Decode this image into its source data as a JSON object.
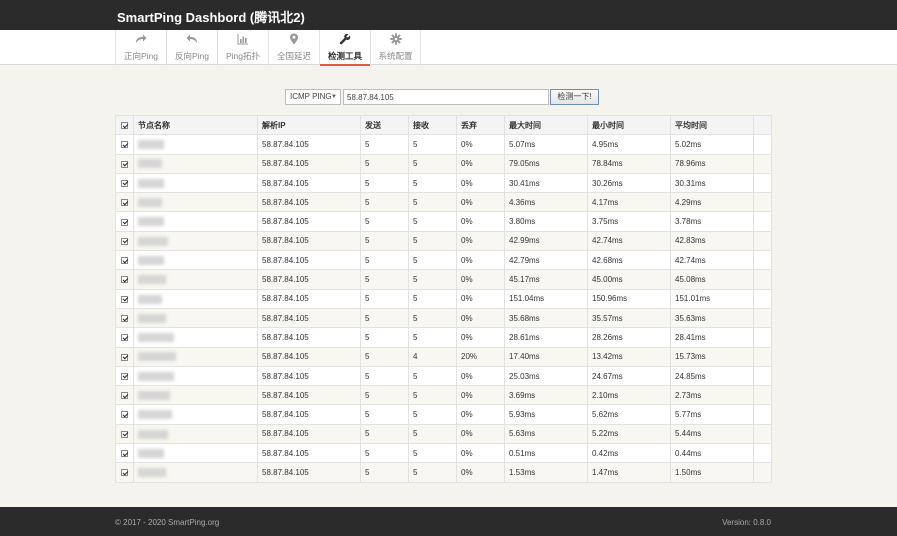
{
  "app": {
    "title": "SmartPing Dashbord (腾讯北2)"
  },
  "nav": [
    {
      "label": "正向Ping",
      "icon": "forward-arrow-icon",
      "active": false
    },
    {
      "label": "反向Ping",
      "icon": "reply-arrow-icon",
      "active": false
    },
    {
      "label": "Ping拓扑",
      "icon": "bar-chart-icon",
      "active": false
    },
    {
      "label": "全国延迟",
      "icon": "map-marker-icon",
      "active": false
    },
    {
      "label": "检测工具",
      "icon": "wrench-icon",
      "active": true
    },
    {
      "label": "系统配置",
      "icon": "gear-icon",
      "active": false
    }
  ],
  "toolbar": {
    "type_selected": "ICMP PING",
    "target_value": "58.87.84.105",
    "run_label": "检测一下!"
  },
  "table": {
    "headers": [
      "节点名称",
      "解析IP",
      "发送",
      "接收",
      "丢弃",
      "最大时间",
      "最小时间",
      "平均时间"
    ],
    "rows": [
      {
        "ip": "58.87.84.105",
        "sent": "5",
        "recv": "5",
        "loss": "0%",
        "max": "5.07ms",
        "min": "4.95ms",
        "avg": "5.02ms"
      },
      {
        "ip": "58.87.84.105",
        "sent": "5",
        "recv": "5",
        "loss": "0%",
        "max": "79.05ms",
        "min": "78.84ms",
        "avg": "78.96ms"
      },
      {
        "ip": "58.87.84.105",
        "sent": "5",
        "recv": "5",
        "loss": "0%",
        "max": "30.41ms",
        "min": "30.26ms",
        "avg": "30.31ms"
      },
      {
        "ip": "58.87.84.105",
        "sent": "5",
        "recv": "5",
        "loss": "0%",
        "max": "4.36ms",
        "min": "4.17ms",
        "avg": "4.29ms"
      },
      {
        "ip": "58.87.84.105",
        "sent": "5",
        "recv": "5",
        "loss": "0%",
        "max": "3.80ms",
        "min": "3.75ms",
        "avg": "3.78ms"
      },
      {
        "ip": "58.87.84.105",
        "sent": "5",
        "recv": "5",
        "loss": "0%",
        "max": "42.99ms",
        "min": "42.74ms",
        "avg": "42.83ms"
      },
      {
        "ip": "58.87.84.105",
        "sent": "5",
        "recv": "5",
        "loss": "0%",
        "max": "42.79ms",
        "min": "42.68ms",
        "avg": "42.74ms"
      },
      {
        "ip": "58.87.84.105",
        "sent": "5",
        "recv": "5",
        "loss": "0%",
        "max": "45.17ms",
        "min": "45.00ms",
        "avg": "45.08ms"
      },
      {
        "ip": "58.87.84.105",
        "sent": "5",
        "recv": "5",
        "loss": "0%",
        "max": "151.04ms",
        "min": "150.96ms",
        "avg": "151.01ms"
      },
      {
        "ip": "58.87.84.105",
        "sent": "5",
        "recv": "5",
        "loss": "0%",
        "max": "35.68ms",
        "min": "35.57ms",
        "avg": "35.63ms"
      },
      {
        "ip": "58.87.84.105",
        "sent": "5",
        "recv": "5",
        "loss": "0%",
        "max": "28.61ms",
        "min": "28.26ms",
        "avg": "28.41ms"
      },
      {
        "ip": "58.87.84.105",
        "sent": "5",
        "recv": "4",
        "loss": "20%",
        "max": "17.40ms",
        "min": "13.42ms",
        "avg": "15.73ms"
      },
      {
        "ip": "58.87.84.105",
        "sent": "5",
        "recv": "5",
        "loss": "0%",
        "max": "25.03ms",
        "min": "24.67ms",
        "avg": "24.85ms"
      },
      {
        "ip": "58.87.84.105",
        "sent": "5",
        "recv": "5",
        "loss": "0%",
        "max": "3.69ms",
        "min": "2.10ms",
        "avg": "2.73ms"
      },
      {
        "ip": "58.87.84.105",
        "sent": "5",
        "recv": "5",
        "loss": "0%",
        "max": "5.93ms",
        "min": "5.62ms",
        "avg": "5.77ms"
      },
      {
        "ip": "58.87.84.105",
        "sent": "5",
        "recv": "5",
        "loss": "0%",
        "max": "5.63ms",
        "min": "5.22ms",
        "avg": "5.44ms"
      },
      {
        "ip": "58.87.84.105",
        "sent": "5",
        "recv": "5",
        "loss": "0%",
        "max": "0.51ms",
        "min": "0.42ms",
        "avg": "0.44ms"
      },
      {
        "ip": "58.87.84.105",
        "sent": "5",
        "recv": "5",
        "loss": "0%",
        "max": "1.53ms",
        "min": "1.47ms",
        "avg": "1.50ms"
      }
    ]
  },
  "footer": {
    "copyright": "© 2017 - 2020 SmartPing.org",
    "version": "Version: 0.8.0"
  },
  "colors": {
    "topbar": "#2b2b2b",
    "accent": "#e25b45",
    "page_bg": "#f5f3ee"
  }
}
